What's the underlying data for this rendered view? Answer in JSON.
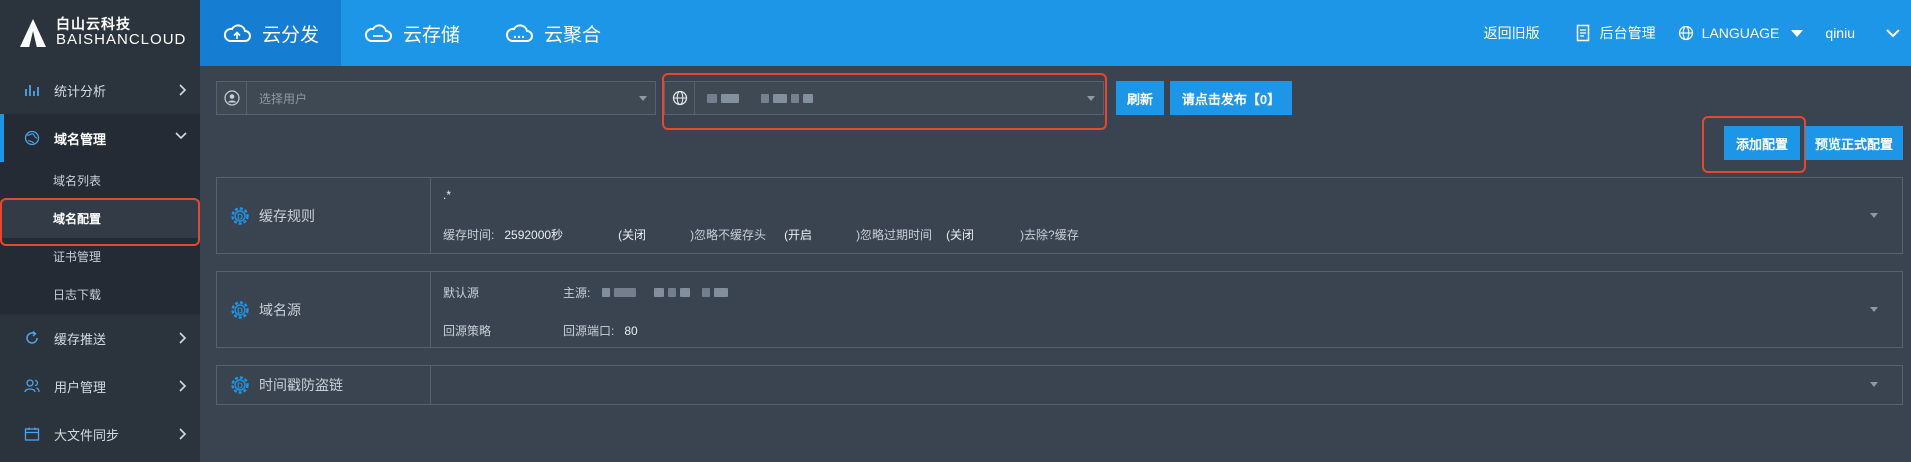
{
  "brand": {
    "name_cn": "白山云科技",
    "name_en": "BAISHANCLOUD"
  },
  "top_nav": {
    "tabs": [
      {
        "label": "云分发",
        "active": true
      },
      {
        "label": "云存储",
        "active": false
      },
      {
        "label": "云聚合",
        "active": false
      }
    ],
    "back_link": "返回旧版",
    "admin": "后台管理",
    "language": "LANGUAGE",
    "user": "qiniu"
  },
  "sidebar": {
    "items": [
      {
        "label": "统计分析",
        "icon": "bar-chart-icon"
      },
      {
        "label": "域名管理",
        "icon": "globe-icon",
        "open": true,
        "children": [
          {
            "label": "域名列表"
          },
          {
            "label": "域名配置",
            "active": true
          },
          {
            "label": "证书管理"
          },
          {
            "label": "日志下载"
          }
        ]
      },
      {
        "label": "缓存推送",
        "icon": "refresh-icon"
      },
      {
        "label": "用户管理",
        "icon": "users-icon"
      },
      {
        "label": "大文件同步",
        "icon": "calendar-icon"
      }
    ]
  },
  "toolbar": {
    "user_select_placeholder": "选择用户",
    "refresh_button": "刷新",
    "publish_button": "请点击发布【0】",
    "add_config_button": "添加配置",
    "preview_button": "预览正式配置"
  },
  "panels": {
    "cache_rules": {
      "title": "缓存规则",
      "pattern": ".*",
      "cache_time_label": "缓存时间:",
      "cache_time_value": "2592000秒",
      "ignore_no_cache_state": "(关闭",
      "ignore_no_cache_label": ")忽略不缓存头",
      "ignore_expire_state": "(开启",
      "ignore_expire_label": ")忽略过期时间",
      "remove_query_state": "(关闭",
      "remove_query_label": ")去除?缓存"
    },
    "origin": {
      "title": "域名源",
      "default_origin_label": "默认源",
      "primary_label": "主源:",
      "strategy_label": "回源策略",
      "port_label": "回源端口:",
      "port_value": "80"
    },
    "hotlink": {
      "title": "时间戳防盗链"
    }
  },
  "colors": {
    "accent": "#1e96e8",
    "sidebar_bg": "#2b333d",
    "content_bg": "#3a4450",
    "highlight": "#e8472d"
  }
}
